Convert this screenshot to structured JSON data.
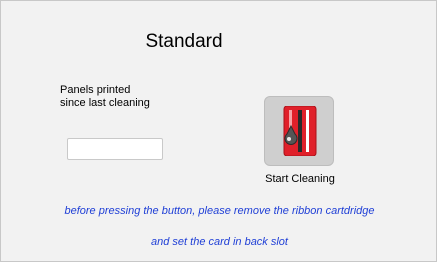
{
  "title": "Standard",
  "counter": {
    "label_line1": "Panels printed",
    "label_line2": "since last cleaning",
    "value": ""
  },
  "clean_button": {
    "icon": "cleaning-card-icon",
    "label": "Start Cleaning"
  },
  "instructions": {
    "line1": "before pressing the button, please remove the ribbon cartdridge",
    "line2": "and set the card in back slot"
  },
  "colors": {
    "instruction_text": "#1f3fd6",
    "icon_red": "#e0202a"
  }
}
